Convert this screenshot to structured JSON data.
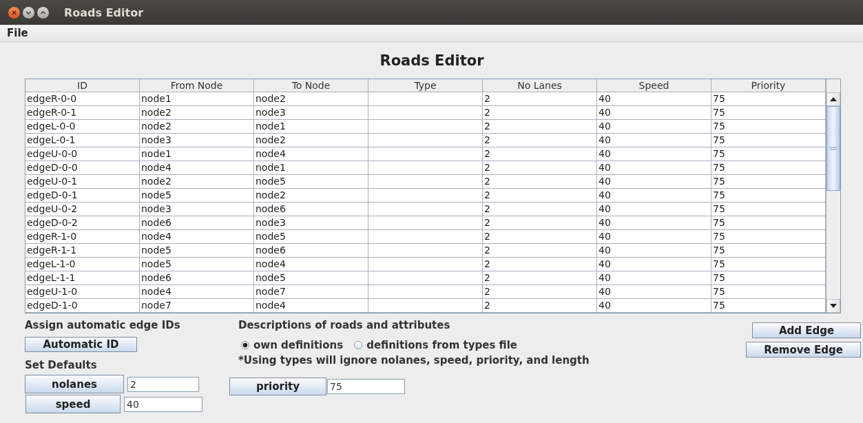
{
  "window": {
    "title": "Roads Editor"
  },
  "menu": [
    "File"
  ],
  "heading": "Roads Editor",
  "table": {
    "columns": [
      "ID",
      "From Node",
      "To Node",
      "Type",
      "No Lanes",
      "Speed",
      "Priority"
    ],
    "rows": [
      [
        "edgeR-0-0",
        "node1",
        "node2",
        "",
        "2",
        "40",
        "75"
      ],
      [
        "edgeR-0-1",
        "node2",
        "node3",
        "",
        "2",
        "40",
        "75"
      ],
      [
        "edgeL-0-0",
        "node2",
        "node1",
        "",
        "2",
        "40",
        "75"
      ],
      [
        "edgeL-0-1",
        "node3",
        "node2",
        "",
        "2",
        "40",
        "75"
      ],
      [
        "edgeU-0-0",
        "node1",
        "node4",
        "",
        "2",
        "40",
        "75"
      ],
      [
        "edgeD-0-0",
        "node4",
        "node1",
        "",
        "2",
        "40",
        "75"
      ],
      [
        "edgeU-0-1",
        "node2",
        "node5",
        "",
        "2",
        "40",
        "75"
      ],
      [
        "edgeD-0-1",
        "node5",
        "node2",
        "",
        "2",
        "40",
        "75"
      ],
      [
        "edgeU-0-2",
        "node3",
        "node6",
        "",
        "2",
        "40",
        "75"
      ],
      [
        "edgeD-0-2",
        "node6",
        "node3",
        "",
        "2",
        "40",
        "75"
      ],
      [
        "edgeR-1-0",
        "node4",
        "node5",
        "",
        "2",
        "40",
        "75"
      ],
      [
        "edgeR-1-1",
        "node5",
        "node6",
        "",
        "2",
        "40",
        "75"
      ],
      [
        "edgeL-1-0",
        "node5",
        "node4",
        "",
        "2",
        "40",
        "75"
      ],
      [
        "edgeL-1-1",
        "node6",
        "node5",
        "",
        "2",
        "40",
        "75"
      ],
      [
        "edgeU-1-0",
        "node4",
        "node7",
        "",
        "2",
        "40",
        "75"
      ],
      [
        "edgeD-1-0",
        "node7",
        "node4",
        "",
        "2",
        "40",
        "75"
      ]
    ]
  },
  "auto_ids": {
    "heading": "Assign automatic edge IDs",
    "button": "Automatic ID"
  },
  "defaults": {
    "heading": "Set Defaults",
    "fields": [
      {
        "button": "nolanes",
        "value": "2"
      },
      {
        "button": "speed",
        "value": "40"
      }
    ]
  },
  "descriptions": {
    "heading": "Descriptions of roads and attributes",
    "options": [
      {
        "label": "own definitions",
        "selected": true
      },
      {
        "label": "definitions from types file",
        "selected": false
      }
    ],
    "note": "*Using types will ignore nolanes, speed, priority, and length",
    "field": {
      "button": "priority",
      "value": "75"
    }
  },
  "actions": [
    "Add Edge",
    "Remove Edge"
  ]
}
